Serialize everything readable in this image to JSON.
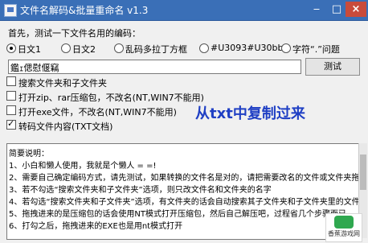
{
  "window": {
    "title": "文件名解码&批量重命名 v1.3"
  },
  "labels": {
    "first": "首先，测试一下文件名用的编码："
  },
  "encoding_options": [
    {
      "label": "日文1",
      "selected": true
    },
    {
      "label": "日文2",
      "selected": false
    },
    {
      "label": "乱码多拉丁方框",
      "selected": false
    },
    {
      "label": "#U3093#U30bb",
      "selected": false
    },
    {
      "label": "字符“.”问题",
      "selected": false
    }
  ],
  "input": {
    "value": "鑑ｪ偲慰偃竊"
  },
  "buttons": {
    "test": "测试"
  },
  "options": [
    {
      "label": "搜索文件夹和子文件夹",
      "checked": false
    },
    {
      "label": "打开zip、rar压缩包，不改名(NT,WIN7不能用)",
      "checked": false
    },
    {
      "label": "打开exe文件，不改名(NT,WIN7不能用)",
      "checked": false
    },
    {
      "label": "转码文件内容(TXT文档)",
      "checked": true
    }
  ],
  "overlay": "从txt中复制过来",
  "notes": {
    "title": "简要说明：",
    "lines": [
      "1、小白和懒人使用，我就是个懒人 = =!",
      "2、需要自己确定编码方式，请先测试，如果转换的文件名是对的，请把需要改名的文件或文件夹拖拽到这个对话框里",
      "3、若不勾选“搜索文件夹和子文件夹”选项，则只改文件名和文件夹的名字",
      "4、若勾选“搜索文件夹和子文件夹”选项，有文件夹的话会自动搜索其子文件夹和子文件夹里的文件",
      "5、拖拽进来的是压缩包的话会使用NT模式打开压缩包，然后自己解压吧，过程省几个步骤而已",
      "6、打勾之后，拖拽进来的EXE也是用nt模式打开"
    ]
  },
  "watermark": "香蕉游戏网"
}
